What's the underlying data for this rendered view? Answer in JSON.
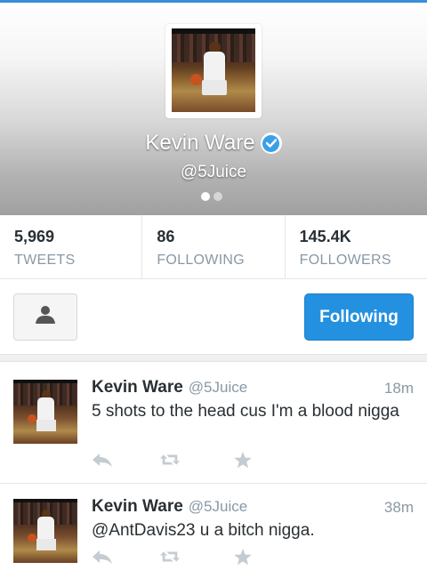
{
  "profile": {
    "name": "Kevin Ware",
    "handle": "@5Juice",
    "verified": true,
    "pager": {
      "pages": 2,
      "active": 1
    }
  },
  "stats": [
    {
      "value": "5,969",
      "label": "TWEETS"
    },
    {
      "value": "86",
      "label": "FOLLOWING"
    },
    {
      "value": "145.4K",
      "label": "FOLLOWERS"
    }
  ],
  "actions": {
    "person_icon": "person-icon",
    "following_label": "Following"
  },
  "tweets": [
    {
      "name": "Kevin Ware",
      "handle": "@5Juice",
      "time": "18m",
      "text": "5 shots to the head cus I'm a blood nigga"
    },
    {
      "name": "Kevin Ware",
      "handle": "@5Juice",
      "time": "38m",
      "text": "@AntDavis23 u a bitch nigga."
    }
  ],
  "colors": {
    "accent": "#2391e0",
    "verified": "#3aa0e8",
    "muted_text": "#8899a6",
    "top_line": "#3a8fd6"
  }
}
